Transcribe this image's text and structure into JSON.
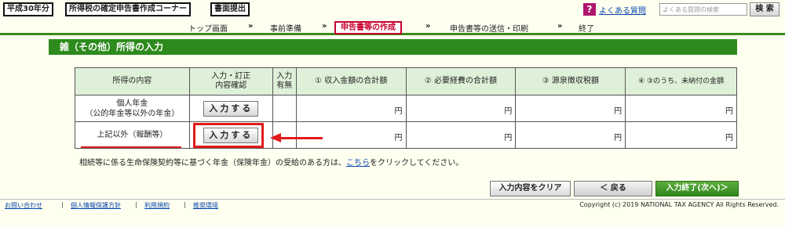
{
  "header": {
    "era_label": "平成30年分",
    "corner_title": "所得税の確定申告書作成コーナー",
    "submit_label": "書面提出",
    "help_icon_glyph": "?",
    "faq_link": "よくある質問",
    "search_placeholder": "よくある質問の検索",
    "search_button": "検 索"
  },
  "steps": {
    "items": [
      "トップ画面",
      "事前準備",
      "申告書等の作成",
      "申告書等の送信・印刷",
      "終了"
    ],
    "separator": "»",
    "active_index": 2
  },
  "page_title": "雑（その他）所得の入力",
  "table": {
    "headers": {
      "content": "所得の内容",
      "confirm": "入力・訂正\n内容確認",
      "has_input": "入力\n有無",
      "col1": "① 収入金額の合計額",
      "col2": "② 必要経費の合計額",
      "col3": "③ 源泉徴収税額",
      "col4": "④ ③のうち、未納付の金額"
    },
    "rows": [
      {
        "label": "個人年金\n（公的年金等以外の年金）",
        "button": "入力する",
        "yen": [
          "円",
          "円",
          "円",
          "円"
        ]
      },
      {
        "label": "上記以外（報酬等）",
        "button": "入力する",
        "yen": [
          "円",
          "円",
          "円",
          "円"
        ]
      }
    ]
  },
  "note": {
    "text_before": "相続等に係る生命保険契約等に基づく年金（保険年金）の受給のある方は、",
    "link": "こちら",
    "text_after": "をクリックしてください。"
  },
  "actions": {
    "clear": "入力内容をクリア",
    "back": "＜ 戻る",
    "next": "入力終了(次へ)＞"
  },
  "footer": {
    "links": [
      "お問い合わせ",
      "個人情報保護方針",
      "利用規約",
      "推奨環境"
    ],
    "separator": "|",
    "copyright": "Copyright (c) 2019 NATIONAL TAX AGENCY All Rights Reserved."
  },
  "colors": {
    "accent_green": "#2d8a1c",
    "highlight_red": "#e21b1b",
    "active_step": "#c7002f"
  }
}
